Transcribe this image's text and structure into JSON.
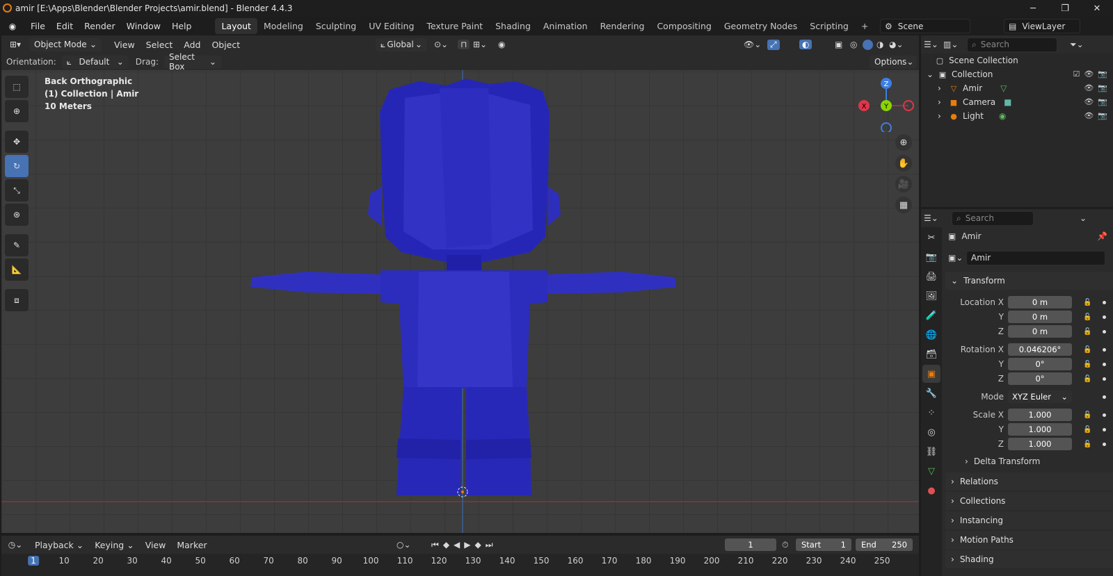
{
  "window": {
    "title": "amir [E:\\Apps\\Blender\\Blender Projects\\amir.blend] - Blender 4.4.3"
  },
  "menus": [
    "File",
    "Edit",
    "Render",
    "Window",
    "Help"
  ],
  "workspaces": [
    "Layout",
    "Modeling",
    "Sculpting",
    "UV Editing",
    "Texture Paint",
    "Shading",
    "Animation",
    "Rendering",
    "Compositing",
    "Geometry Nodes",
    "Scripting"
  ],
  "active_workspace": "Layout",
  "scene": {
    "label": "Scene",
    "view_layer": "ViewLayer"
  },
  "viewport_header": {
    "mode": "Object Mode",
    "menus": [
      "View",
      "Select",
      "Add",
      "Object"
    ],
    "transform": "Global"
  },
  "tool_settings": {
    "orientation_label": "Orientation:",
    "orientation_value": "Default",
    "drag_label": "Drag:",
    "drag_value": "Select Box",
    "options": "Options"
  },
  "viewport_info": {
    "view": "Back Orthographic",
    "collection": "(1) Collection | Amir",
    "scale": "10 Meters"
  },
  "gizmo": {
    "x": "X",
    "y": "Y",
    "z": "Z"
  },
  "outliner": {
    "search_placeholder": "Search",
    "root": "Scene Collection",
    "collection": "Collection",
    "items": [
      "Amir",
      "Camera",
      "Light"
    ]
  },
  "properties": {
    "search_placeholder": "Search",
    "object_name": "Amir",
    "object_field": "Amir",
    "transform_header": "Transform",
    "location": {
      "label_x": "Location X",
      "x": "0 m",
      "y": "0 m",
      "z": "0 m"
    },
    "rotation": {
      "label_x": "Rotation X",
      "x": "0.046206°",
      "y": "0°",
      "z": "0°"
    },
    "mode_label": "Mode",
    "mode_value": "XYZ Euler",
    "scale": {
      "label_x": "Scale X",
      "x": "1.000",
      "y": "1.000",
      "z": "1.000"
    },
    "axis_y": "Y",
    "axis_z": "Z",
    "delta": "Delta Transform",
    "panels": [
      "Relations",
      "Collections",
      "Instancing",
      "Motion Paths",
      "Shading"
    ]
  },
  "timeline": {
    "menus": [
      "Playback",
      "Keying",
      "View",
      "Marker"
    ],
    "current_frame": "1",
    "start_label": "Start",
    "start": "1",
    "end_label": "End",
    "end": "250",
    "ticks": [
      "1",
      "10",
      "20",
      "30",
      "40",
      "50",
      "60",
      "70",
      "80",
      "90",
      "100",
      "110",
      "120",
      "130",
      "140",
      "150",
      "160",
      "170",
      "180",
      "190",
      "200",
      "210",
      "220",
      "230",
      "240",
      "250"
    ]
  },
  "colors": {
    "accent": "#4772b3",
    "mesh": "#2424b8",
    "x_axis": "#e0364a",
    "y_axis": "#8bd400",
    "z_axis": "#3d7ee0"
  }
}
